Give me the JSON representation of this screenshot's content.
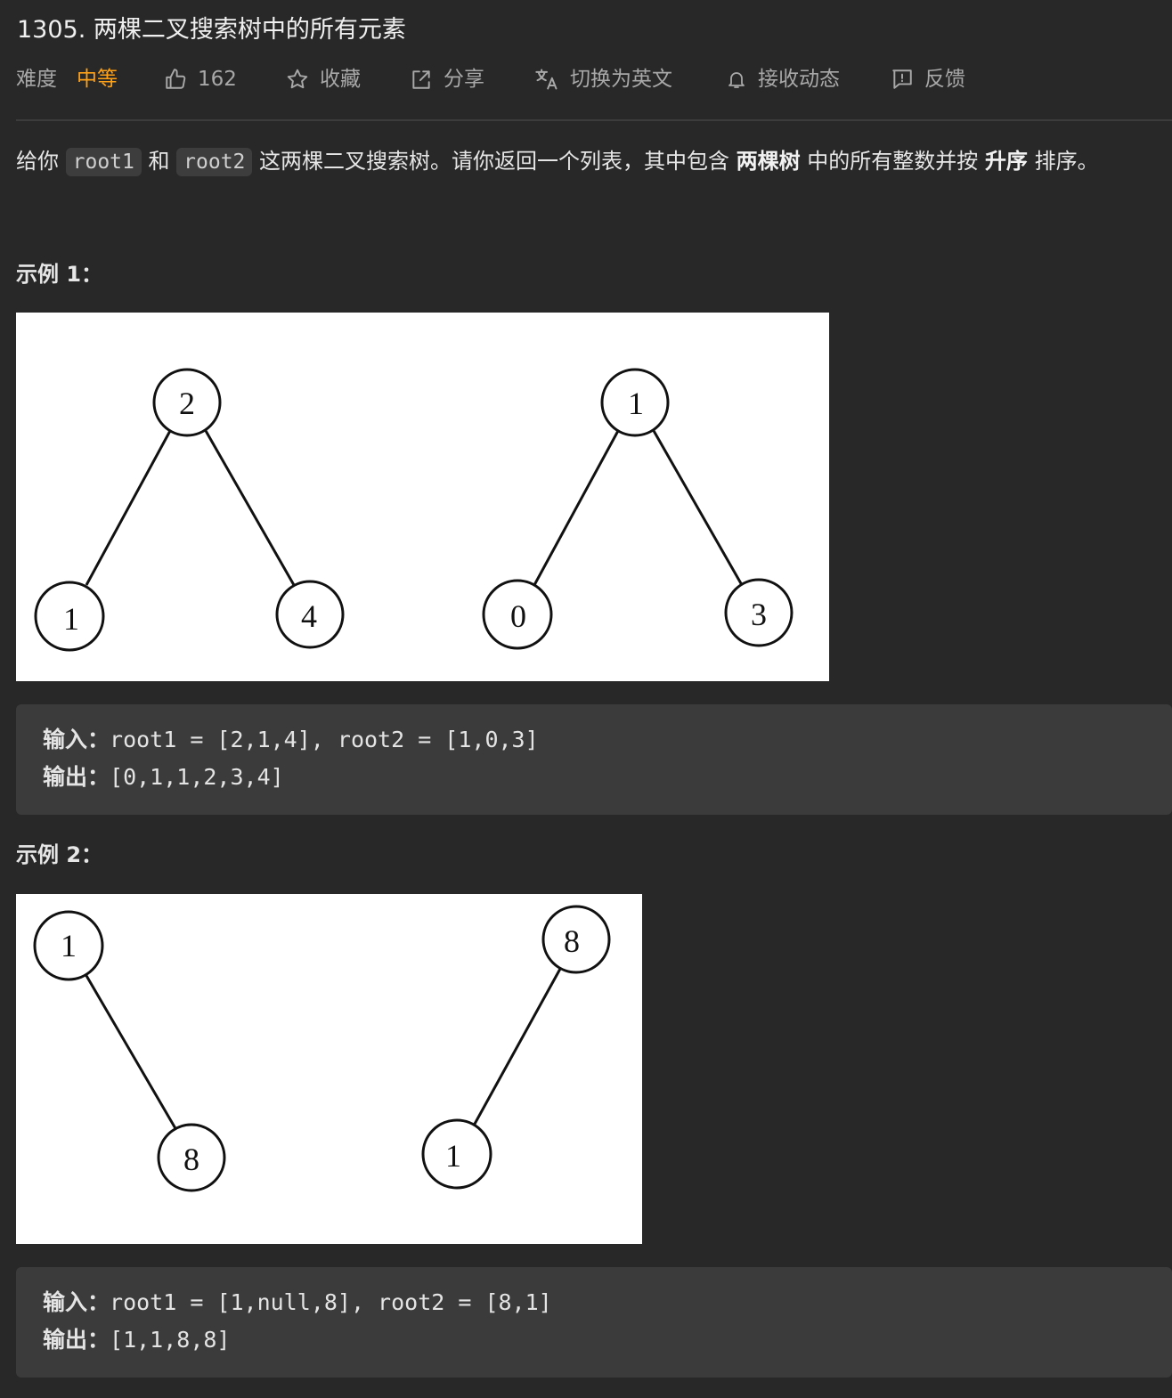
{
  "problem": {
    "title": "1305. 两棵二叉搜索树中的所有元素"
  },
  "meta": {
    "difficulty_label": "难度",
    "difficulty_value": "中等",
    "likes": "162",
    "favorite": "收藏",
    "share": "分享",
    "translate": "切换为英文",
    "subscribe": "接收动态",
    "feedback": "反馈",
    "accent_color": "#ffa116"
  },
  "description": {
    "part1": "给你 ",
    "code1": "root1",
    "part2": " 和 ",
    "code2": "root2",
    "part3": " 这两棵二叉搜索树。请你返回一个列表，其中包含 ",
    "bold1": "两棵树",
    "part4": " 中的所有整数并按 ",
    "bold2": "升序",
    "part5": " 排序。"
  },
  "examples": [
    {
      "title": "示例 1：",
      "input_label": "输入：",
      "input_value": "root1 = [2,1,4], root2 = [1,0,3]",
      "output_label": "输出：",
      "output_value": "[0,1,1,2,3,4]",
      "tree_nodes": [
        "2",
        "1",
        "4",
        "1",
        "0",
        "3"
      ]
    },
    {
      "title": "示例 2：",
      "input_label": "输入：",
      "input_value": "root1 = [1,null,8], root2 = [8,1]",
      "output_label": "输出：",
      "output_value": "[1,1,8,8]",
      "tree_nodes": [
        "1",
        "8",
        "8",
        "1"
      ]
    }
  ]
}
